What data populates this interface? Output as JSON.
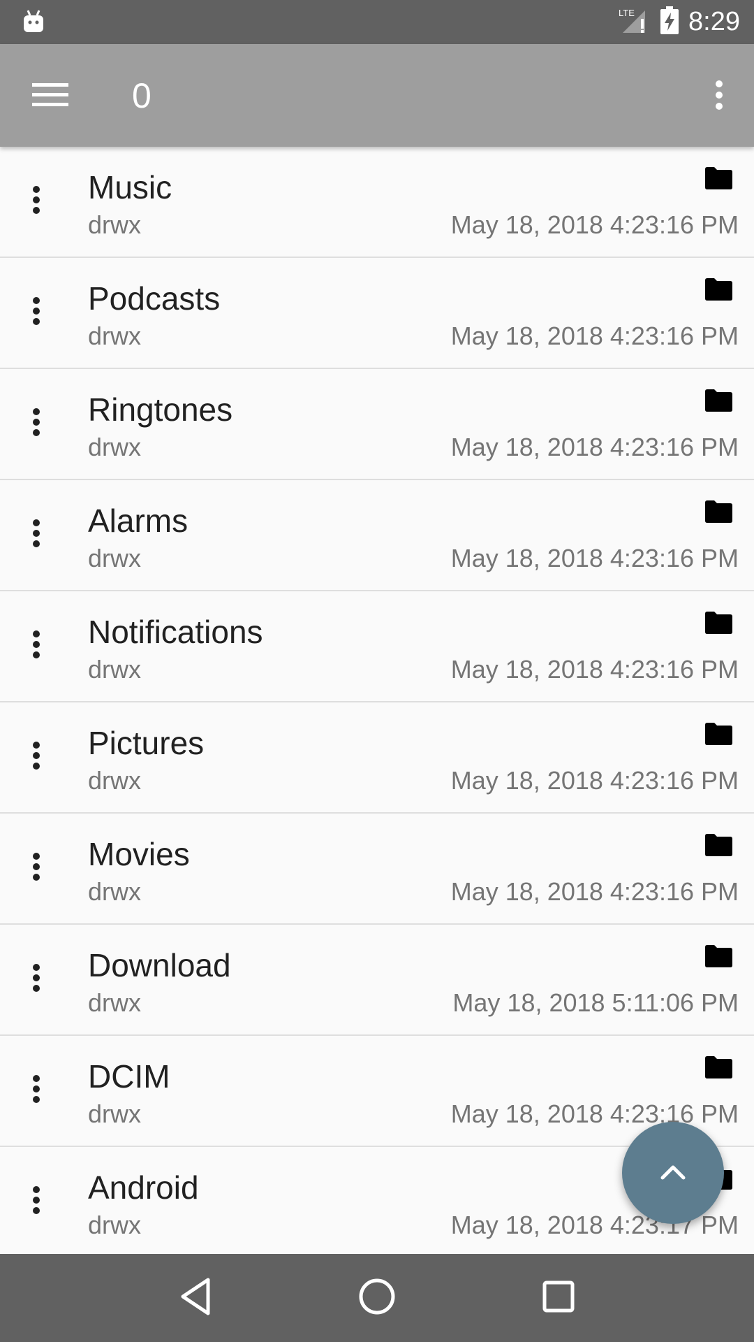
{
  "status_bar": {
    "time": "8:29",
    "network": "LTE",
    "icons": [
      "android-debug-icon",
      "signal-icon",
      "battery-charging-icon"
    ]
  },
  "app_bar": {
    "title": "0",
    "menu_icon": "hamburger-menu-icon",
    "overflow_icon": "more-vert-icon"
  },
  "files": [
    {
      "name": "Music",
      "perm": "drwx",
      "date": "May 18, 2018 4:23:16 PM",
      "icon": "folder-icon"
    },
    {
      "name": "Podcasts",
      "perm": "drwx",
      "date": "May 18, 2018 4:23:16 PM",
      "icon": "folder-icon"
    },
    {
      "name": "Ringtones",
      "perm": "drwx",
      "date": "May 18, 2018 4:23:16 PM",
      "icon": "folder-icon"
    },
    {
      "name": "Alarms",
      "perm": "drwx",
      "date": "May 18, 2018 4:23:16 PM",
      "icon": "folder-icon"
    },
    {
      "name": "Notifications",
      "perm": "drwx",
      "date": "May 18, 2018 4:23:16 PM",
      "icon": "folder-icon"
    },
    {
      "name": "Pictures",
      "perm": "drwx",
      "date": "May 18, 2018 4:23:16 PM",
      "icon": "folder-icon"
    },
    {
      "name": "Movies",
      "perm": "drwx",
      "date": "May 18, 2018 4:23:16 PM",
      "icon": "folder-icon"
    },
    {
      "name": "Download",
      "perm": "drwx",
      "date": "May 18, 2018 5:11:06 PM",
      "icon": "folder-icon"
    },
    {
      "name": "DCIM",
      "perm": "drwx",
      "date": "May 18, 2018 4:23:16 PM",
      "icon": "folder-icon"
    },
    {
      "name": "Android",
      "perm": "drwx",
      "date": "May 18, 2018 4:23:17 PM",
      "icon": "folder-icon"
    }
  ],
  "fab": {
    "icon": "chevron-up-icon"
  },
  "nav_bar": {
    "buttons": [
      "back-icon",
      "home-icon",
      "recents-icon"
    ]
  },
  "colors": {
    "status_bar": "#616161",
    "app_bar": "#9e9e9e",
    "fab": "#5d7d8f",
    "background": "#fafafa"
  }
}
